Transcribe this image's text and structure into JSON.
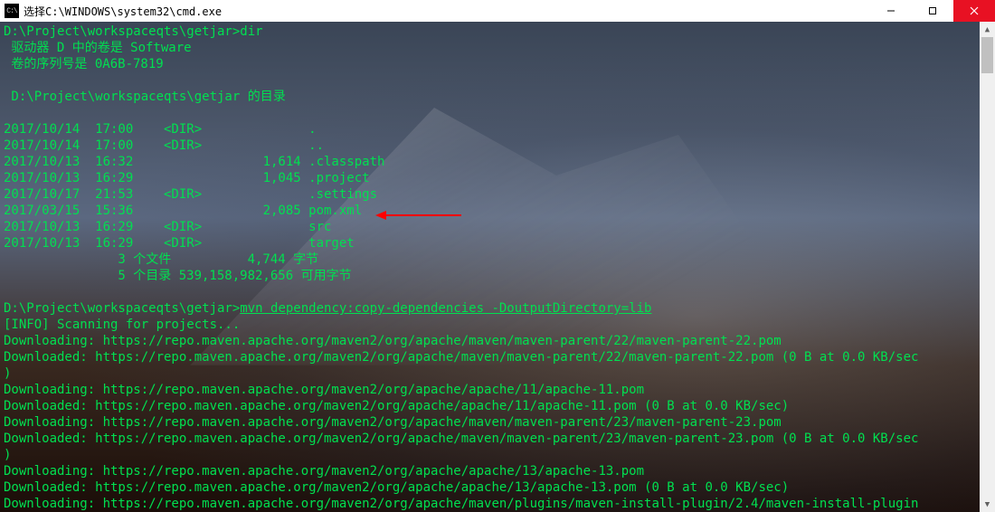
{
  "window": {
    "icon_label": "C:\\",
    "title": "选择C:\\WINDOWS\\system32\\cmd.exe"
  },
  "dir_header": {
    "prompt": "D:\\Project\\workspaceqts\\getjar>",
    "cmd": "dir",
    "vol_line": " 驱动器 D 中的卷是 Software",
    "sn_line": " 卷的序列号是 0A6B-7819",
    "path_line": " D:\\Project\\workspaceqts\\getjar 的目录"
  },
  "entries": [
    {
      "date": "2017/10/14",
      "time": "17:00",
      "dir": "<DIR>",
      "size": "",
      "name": "."
    },
    {
      "date": "2017/10/14",
      "time": "17:00",
      "dir": "<DIR>",
      "size": "",
      "name": ".."
    },
    {
      "date": "2017/10/13",
      "time": "16:32",
      "dir": "",
      "size": "1,614",
      "name": ".classpath"
    },
    {
      "date": "2017/10/13",
      "time": "16:29",
      "dir": "",
      "size": "1,045",
      "name": ".project"
    },
    {
      "date": "2017/10/17",
      "time": "21:53",
      "dir": "<DIR>",
      "size": "",
      "name": ".settings"
    },
    {
      "date": "2017/03/15",
      "time": "15:36",
      "dir": "",
      "size": "2,085",
      "name": "pom.xml"
    },
    {
      "date": "2017/10/13",
      "time": "16:29",
      "dir": "<DIR>",
      "size": "",
      "name": "src"
    },
    {
      "date": "2017/10/13",
      "time": "16:29",
      "dir": "<DIR>",
      "size": "",
      "name": "target"
    }
  ],
  "summary": {
    "files": "               3 个文件          4,744 字节",
    "dirs": "               5 个目录 539,158,982,656 可用字节"
  },
  "mvn": {
    "prompt": "D:\\Project\\workspaceqts\\getjar>",
    "cmd": "mvn dependency:copy-dependencies -DoutputDirectory=lib"
  },
  "out": [
    "[INFO] Scanning for projects...",
    "Downloading: https://repo.maven.apache.org/maven2/org/apache/maven/maven-parent/22/maven-parent-22.pom",
    "Downloaded: https://repo.maven.apache.org/maven2/org/apache/maven/maven-parent/22/maven-parent-22.pom (0 B at 0.0 KB/sec",
    ")",
    "Downloading: https://repo.maven.apache.org/maven2/org/apache/apache/11/apache-11.pom",
    "Downloaded: https://repo.maven.apache.org/maven2/org/apache/apache/11/apache-11.pom (0 B at 0.0 KB/sec)",
    "Downloading: https://repo.maven.apache.org/maven2/org/apache/maven/maven-parent/23/maven-parent-23.pom",
    "Downloaded: https://repo.maven.apache.org/maven2/org/apache/maven/maven-parent/23/maven-parent-23.pom (0 B at 0.0 KB/sec",
    ")",
    "Downloading: https://repo.maven.apache.org/maven2/org/apache/apache/13/apache-13.pom",
    "Downloaded: https://repo.maven.apache.org/maven2/org/apache/apache/13/apache-13.pom (0 B at 0.0 KB/sec)",
    "Downloading: https://repo.maven.apache.org/maven2/org/apache/maven/plugins/maven-install-plugin/2.4/maven-install-plugin"
  ]
}
